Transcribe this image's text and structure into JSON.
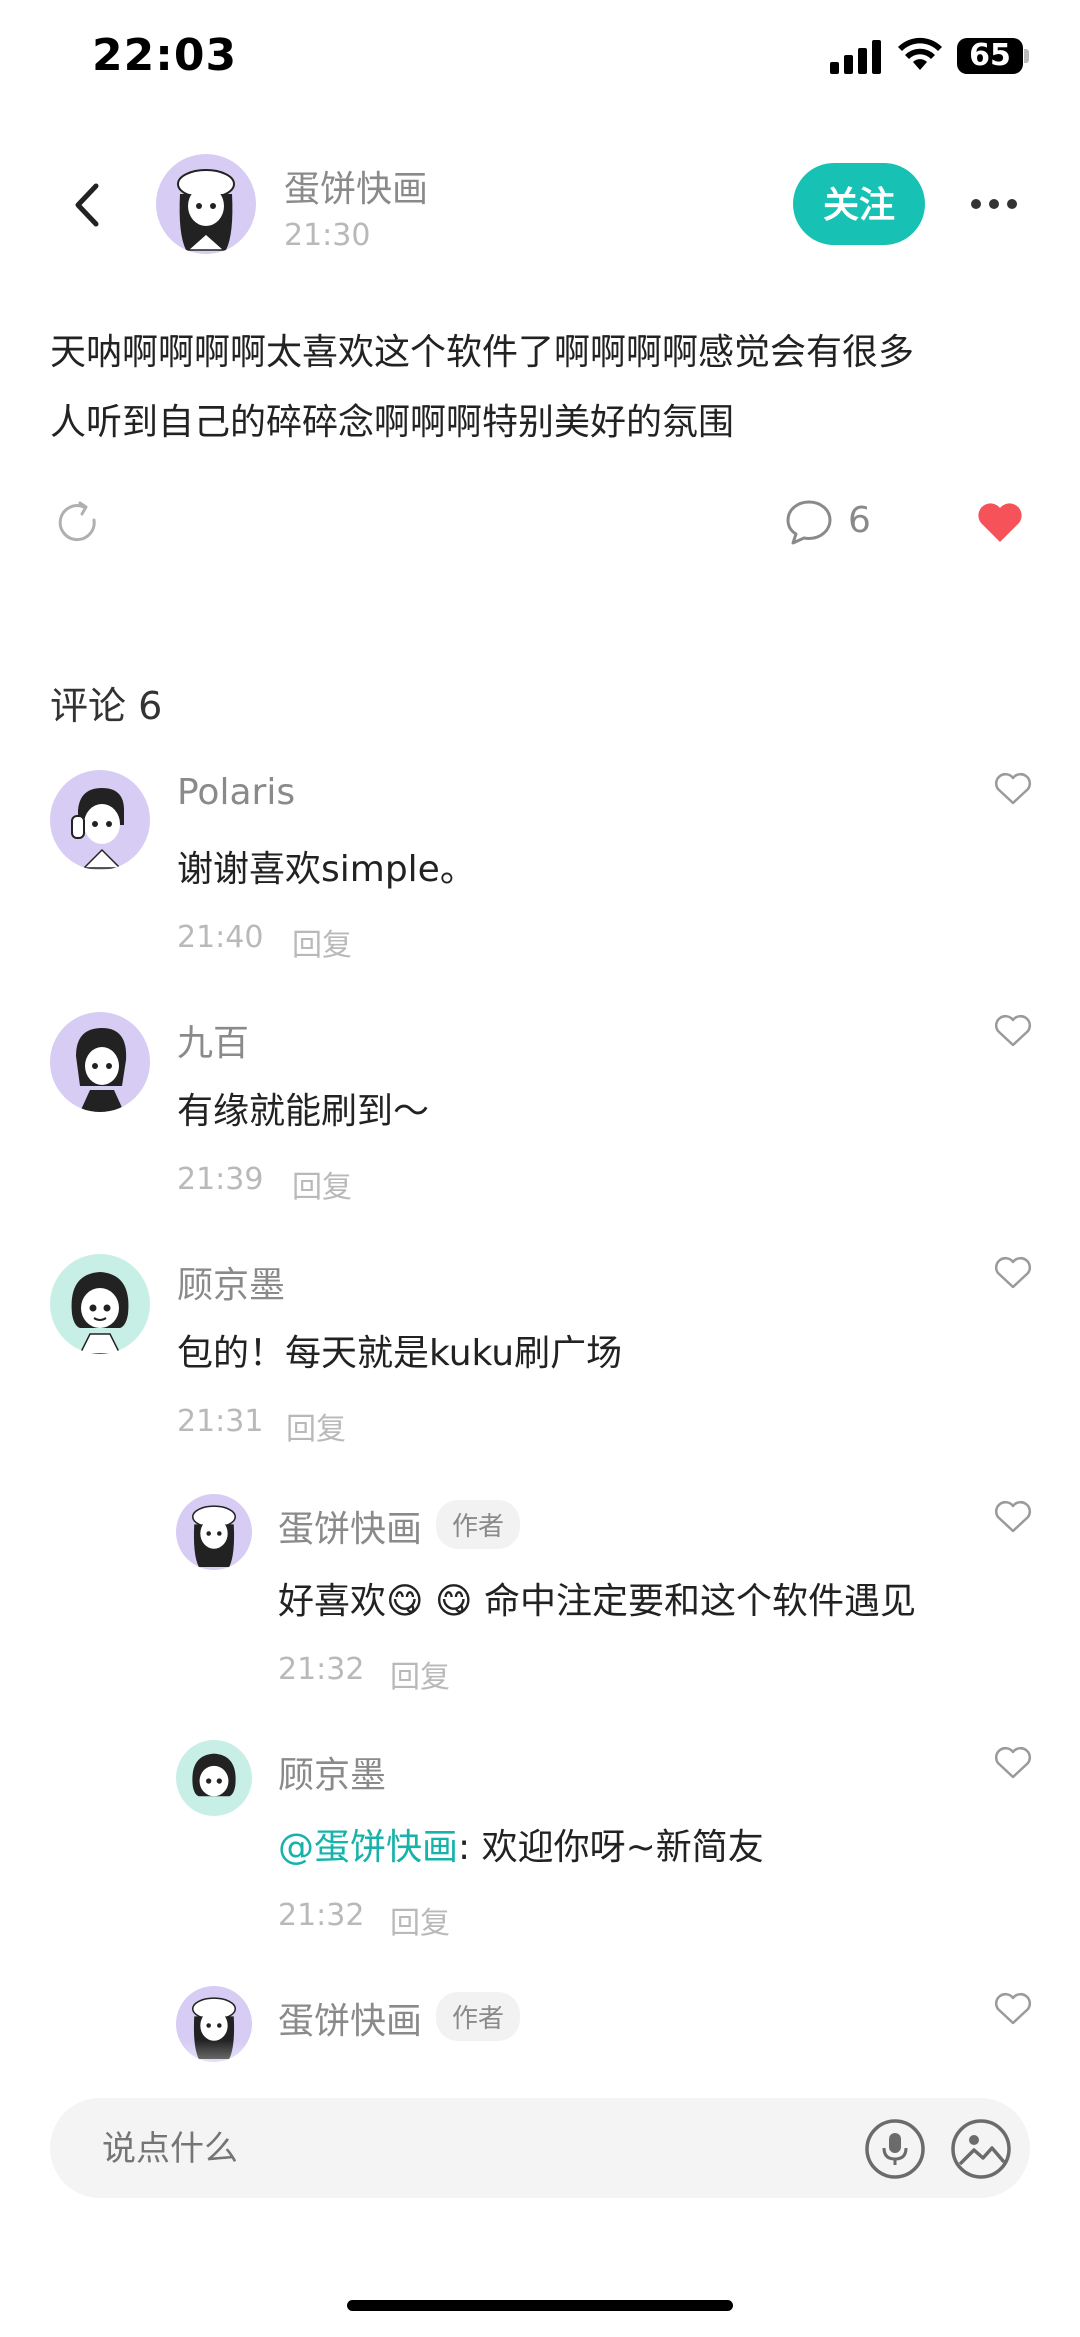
{
  "status_bar": {
    "time": "22:03",
    "battery": "65"
  },
  "post": {
    "author": "蛋饼快画",
    "time": "21:30",
    "follow_label": "关注",
    "content_line1": "天呐啊啊啊啊太喜欢这个软件了啊啊啊啊感觉会有很多",
    "content_line2": "人听到自己的碎碎念啊啊啊特别美好的氛围",
    "comment_count": "6"
  },
  "comments_header": "评论 6",
  "reply_label": "回复",
  "author_tag": "作者",
  "comments": [
    {
      "name": "Polaris",
      "text": "谢谢喜欢simple。",
      "time": "21:40"
    },
    {
      "name": "九百",
      "text": "有缘就能刷到～",
      "time": "21:39"
    },
    {
      "name": "顾京墨",
      "text": "包的！每天就是kuku刷广场",
      "time": "21:31"
    }
  ],
  "replies": [
    {
      "name": "蛋饼快画",
      "text": "好喜欢😋 😋 命中注定要和这个软件遇见",
      "time": "21:32"
    },
    {
      "name": "顾京墨",
      "mention": "@蛋饼快画",
      "text": ": 欢迎你呀~新简友",
      "time": "21:32"
    },
    {
      "name": "蛋饼快画"
    }
  ],
  "input": {
    "placeholder": "说点什么"
  },
  "colors": {
    "accent": "#17c1b4",
    "like": "#f5525a",
    "avatar_purple": "#d6ccf4",
    "avatar_teal": "#c8efe6"
  }
}
